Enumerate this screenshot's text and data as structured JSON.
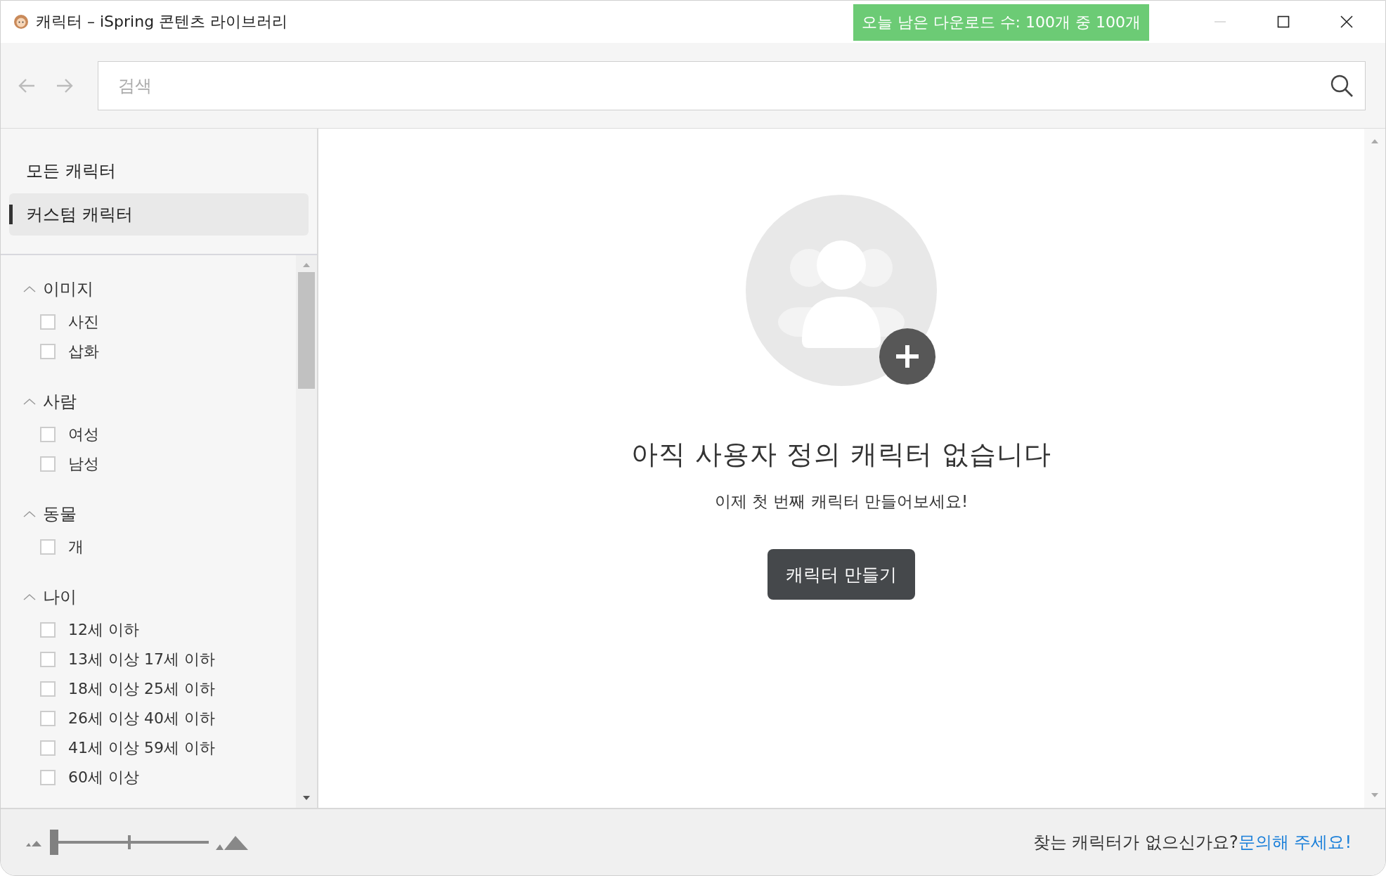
{
  "window": {
    "title": "캐릭터 – iSpring 콘텐츠 라이브러리"
  },
  "download_badge": "오늘 남은 다운로드 수: 100개 중 100개",
  "search": {
    "placeholder": "검색"
  },
  "nav": [
    {
      "label": "모든 캐릭터",
      "selected": false
    },
    {
      "label": "커스텀 캐릭터",
      "selected": true
    }
  ],
  "filters": [
    {
      "title": "이미지",
      "expanded": true,
      "options": [
        {
          "label": "사진",
          "checked": false
        },
        {
          "label": "삽화",
          "checked": false
        }
      ]
    },
    {
      "title": "사람",
      "expanded": true,
      "options": [
        {
          "label": "여성",
          "checked": false
        },
        {
          "label": "남성",
          "checked": false
        }
      ]
    },
    {
      "title": "동물",
      "expanded": true,
      "options": [
        {
          "label": "개",
          "checked": false
        }
      ]
    },
    {
      "title": "나이",
      "expanded": true,
      "options": [
        {
          "label": "12세 이하",
          "checked": false
        },
        {
          "label": "13세 이상 17세 이하",
          "checked": false
        },
        {
          "label": "18세 이상 25세 이하",
          "checked": false
        },
        {
          "label": "26세 이상 40세 이하",
          "checked": false
        },
        {
          "label": "41세 이상 59세 이하",
          "checked": false
        },
        {
          "label": "60세 이상",
          "checked": false
        }
      ]
    }
  ],
  "empty_state": {
    "title": "아직 사용자 정의 캐릭터 없습니다",
    "message": "이제 첫 번째 캐릭터 만들어보세요!",
    "button": "캐릭터 만들기"
  },
  "zoom_slider": {
    "level": 0
  },
  "footer": {
    "text": "찾는 캐릭터가 없으신가요?",
    "link": "문의해 주세요!"
  }
}
